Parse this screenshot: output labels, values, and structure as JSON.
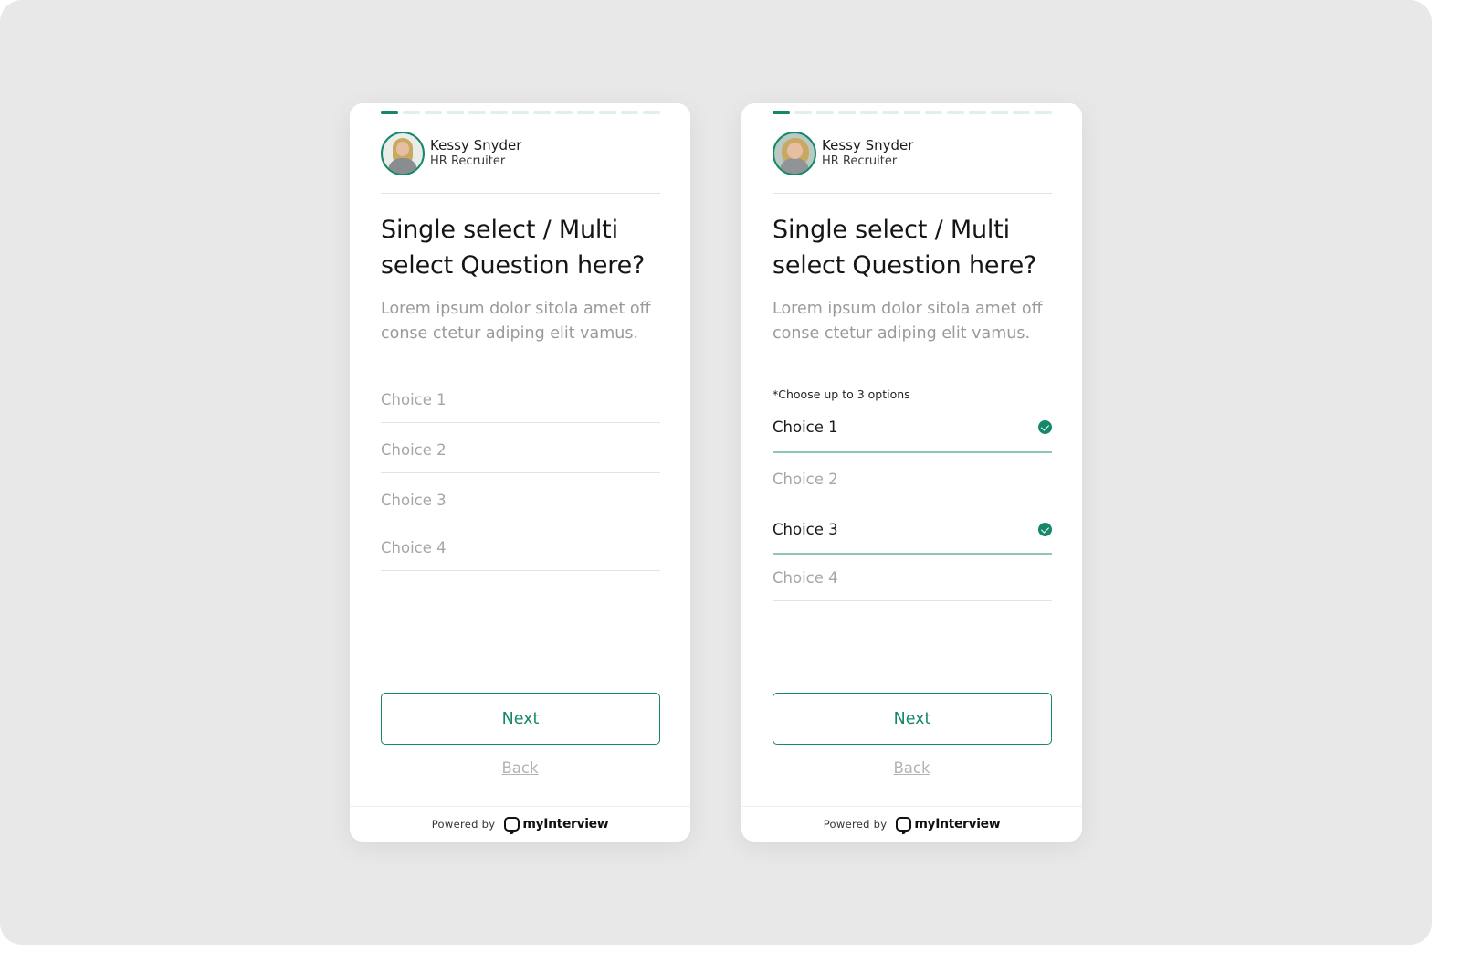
{
  "colors": {
    "accent": "#16876a",
    "progress_inactive": "#dff0ec",
    "selected_underline": "#8cc7b7",
    "muted_text": "#a6a6a6"
  },
  "cards": [
    {
      "variant": "single-select",
      "progress": {
        "current_step": 1,
        "total_steps": 13
      },
      "recruiter": {
        "name": "Kessy Snyder",
        "role": "HR Recruiter"
      },
      "question": {
        "title": "Single select / Multi select Question here?",
        "description": "Lorem ipsum dolor sitola amet off conse ctetur adiping elit vamus."
      },
      "hint": null,
      "choices": [
        {
          "label": "Choice 1",
          "selected": false
        },
        {
          "label": "Choice 2",
          "selected": false
        },
        {
          "label": "Choice 3",
          "selected": false
        },
        {
          "label": "Choice 4",
          "selected": false
        }
      ],
      "next_label": "Next",
      "back_label": "Back",
      "footer": {
        "powered_by": "Powered by",
        "brand": "myInterview"
      }
    },
    {
      "variant": "multi-select",
      "progress": {
        "current_step": 1,
        "total_steps": 13
      },
      "recruiter": {
        "name": "Kessy Snyder",
        "role": "HR Recruiter"
      },
      "question": {
        "title": "Single select / Multi select Question here?",
        "description": "Lorem ipsum dolor sitola amet off conse ctetur adiping elit vamus."
      },
      "hint": "*Choose up to 3 options",
      "choices": [
        {
          "label": "Choice 1",
          "selected": true,
          "icon": "check-circle-icon"
        },
        {
          "label": "Choice 2",
          "selected": false
        },
        {
          "label": "Choice 3",
          "selected": true,
          "icon": "check-circle-icon"
        },
        {
          "label": "Choice 4",
          "selected": false
        }
      ],
      "next_label": "Next",
      "back_label": "Back",
      "footer": {
        "powered_by": "Powered by",
        "brand": "myInterview"
      }
    }
  ]
}
